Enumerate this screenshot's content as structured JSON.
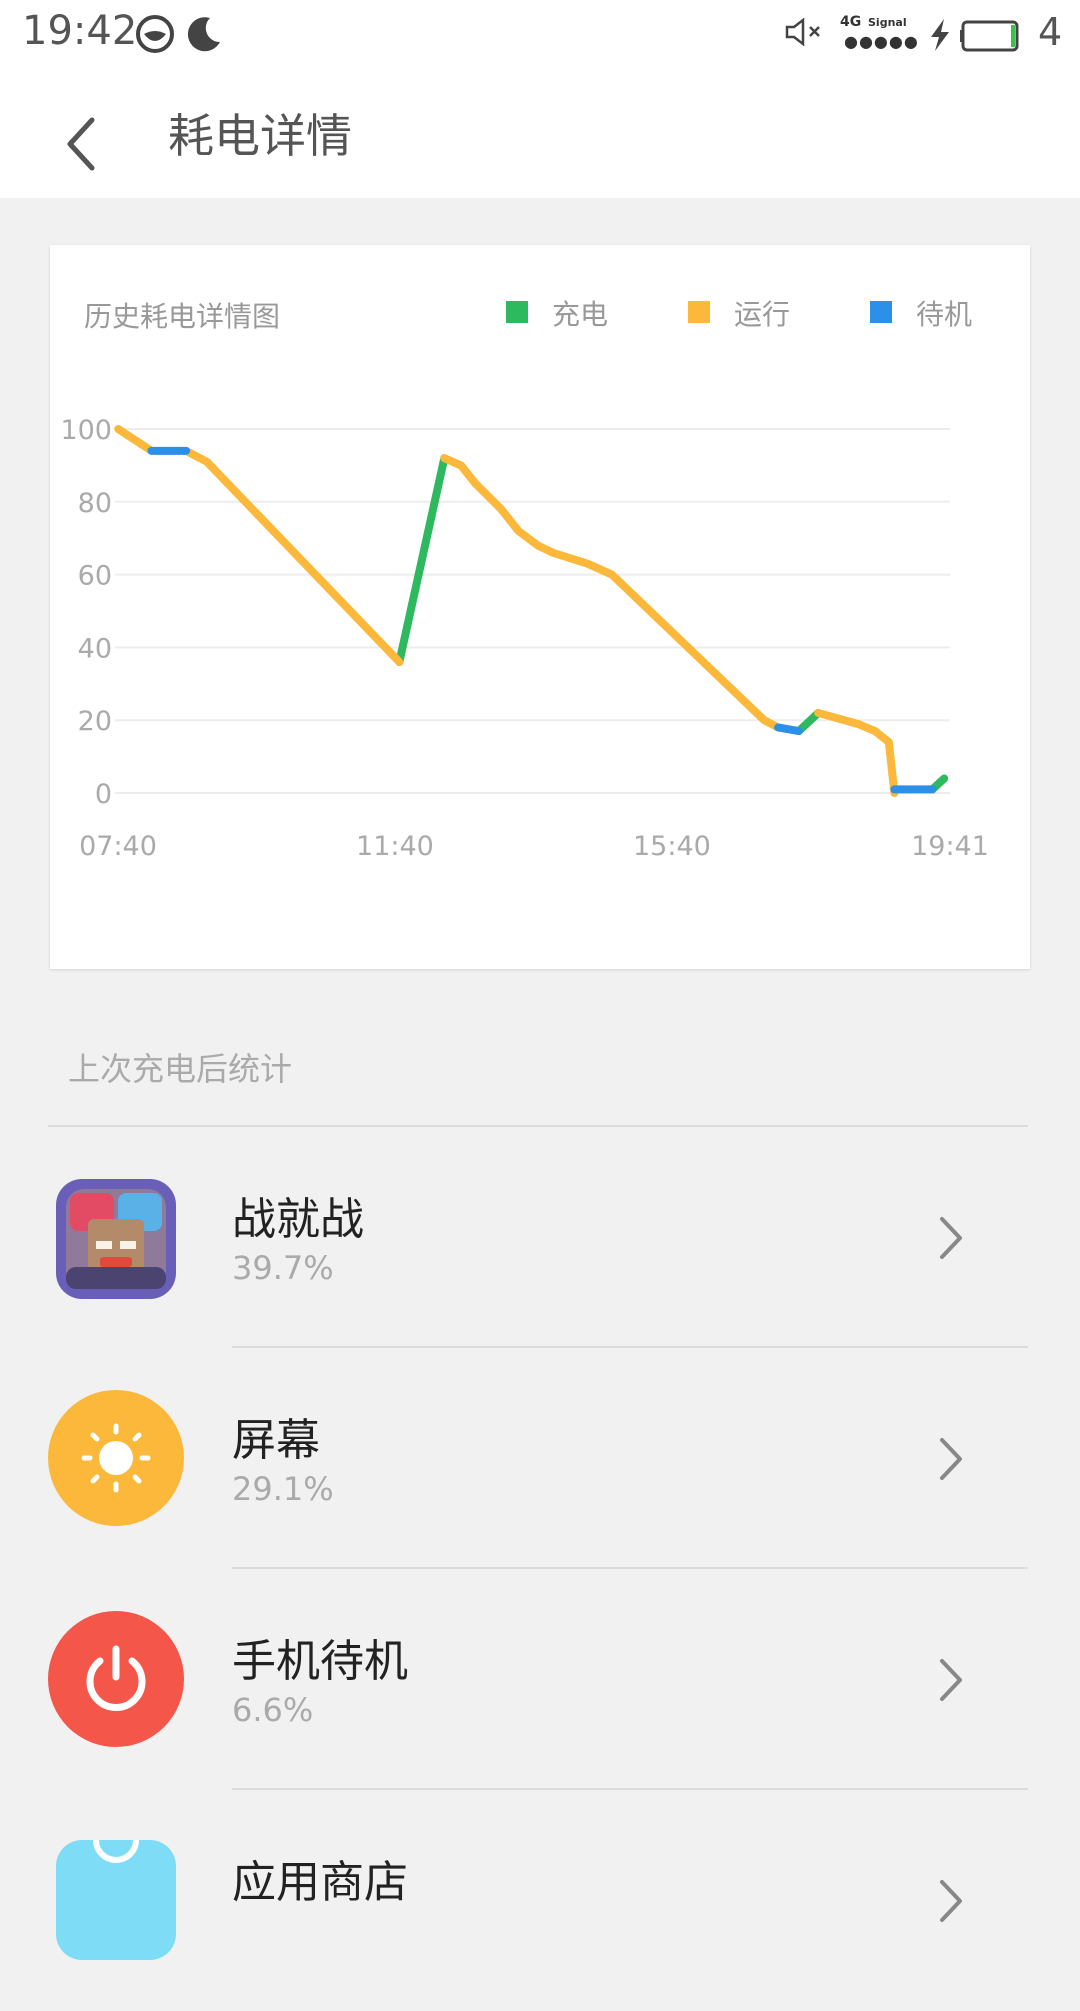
{
  "status_bar": {
    "time": "19:42",
    "network_label": "4G",
    "signal_label": "Signal",
    "signal_dots": "●●●●●",
    "battery_level": "4",
    "icons": [
      "face-icon",
      "moon-icon",
      "mute-icon",
      "network-signal-icon",
      "charging-bolt-icon",
      "battery-icon"
    ]
  },
  "header": {
    "title": "耗电详情",
    "back_icon": "back-arrow-icon"
  },
  "chart_card": {
    "title": "历史耗电详情图",
    "legend": [
      {
        "label": "充电",
        "color": "#2dba5e"
      },
      {
        "label": "运行",
        "color": "#fbb83a"
      },
      {
        "label": "待机",
        "color": "#2c8fe8"
      }
    ]
  },
  "chart_data": {
    "type": "line",
    "title": "历史耗电详情图",
    "xlabel": "",
    "ylabel": "",
    "ylim": [
      0,
      100
    ],
    "y_ticks": [
      "100",
      "80",
      "60",
      "40",
      "20",
      "0"
    ],
    "x_ticks": [
      "07:40",
      "11:40",
      "15:40",
      "19:41"
    ],
    "grid": true,
    "legend_position": "top-right",
    "x_unit": "hours",
    "x_range": [
      7.6667,
      19.6833
    ],
    "series": [
      {
        "name": "充电",
        "color": "#2dba5e",
        "segments": [
          [
            [
              11.73,
              36
            ],
            [
              12.38,
              92
            ]
          ],
          [
            [
              17.5,
              17
            ],
            [
              17.78,
              22
            ]
          ],
          [
            [
              19.43,
              1
            ],
            [
              19.6,
              4
            ]
          ]
        ]
      },
      {
        "name": "运行",
        "color": "#fbb83a",
        "segments": [
          [
            [
              7.67,
              100
            ],
            [
              8.15,
              94
            ]
          ],
          [
            [
              8.65,
              94
            ],
            [
              8.75,
              93
            ],
            [
              8.95,
              91
            ],
            [
              11.73,
              36
            ]
          ],
          [
            [
              12.38,
              92
            ],
            [
              12.62,
              90
            ],
            [
              12.83,
              85
            ],
            [
              13.2,
              78
            ],
            [
              13.45,
              72
            ],
            [
              13.73,
              68
            ],
            [
              13.95,
              66
            ],
            [
              14.45,
              63
            ],
            [
              14.8,
              60
            ]
          ],
          [
            [
              14.8,
              60
            ],
            [
              17.0,
              20
            ],
            [
              17.2,
              18
            ]
          ],
          [
            [
              17.78,
              22
            ],
            [
              18.35,
              19
            ],
            [
              18.6,
              17
            ],
            [
              18.8,
              14
            ],
            [
              18.88,
              0
            ]
          ]
        ]
      },
      {
        "name": "待机",
        "color": "#2c8fe8",
        "segments": [
          [
            [
              8.15,
              94
            ],
            [
              8.65,
              94
            ]
          ],
          [
            [
              17.2,
              18
            ],
            [
              17.5,
              17
            ]
          ],
          [
            [
              18.88,
              1
            ],
            [
              19.43,
              1
            ]
          ]
        ]
      }
    ]
  },
  "section": {
    "title": "上次充电后统计"
  },
  "items": [
    {
      "name": "战就战",
      "percent": "39.7%",
      "icon": "game-app-icon",
      "chevron": "chevron-right-icon"
    },
    {
      "name": "屏幕",
      "percent": "29.1%",
      "icon": "brightness-icon",
      "icon_color": "#fbb83a",
      "chevron": "chevron-right-icon"
    },
    {
      "name": "手机待机",
      "percent": "6.6%",
      "icon": "power-icon",
      "icon_color": "#f4564a",
      "chevron": "chevron-right-icon"
    },
    {
      "name": "应用商店",
      "percent": "",
      "icon": "app-store-icon",
      "icon_color": "#7fdcf6",
      "chevron": "chevron-right-icon"
    }
  ]
}
